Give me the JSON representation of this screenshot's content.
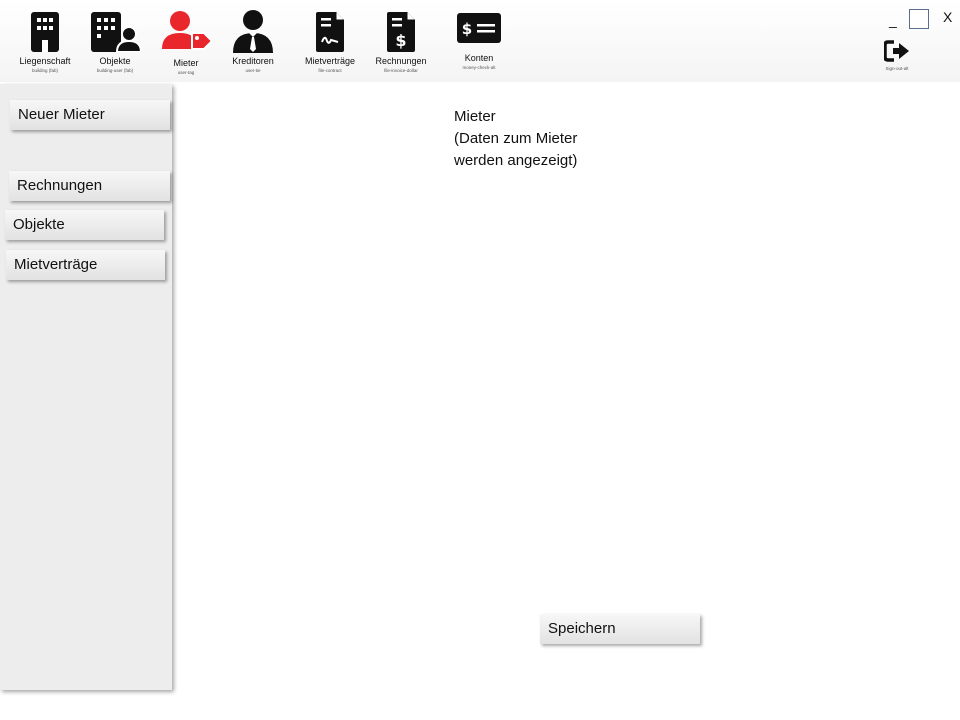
{
  "toolbar": {
    "items": [
      {
        "label": "Liegenschaft",
        "sub": "building (fab)",
        "icon": "building-icon"
      },
      {
        "label": "Objekte",
        "sub": "building-user (fab)",
        "icon": "building-user-icon"
      },
      {
        "label": "Mieter",
        "sub": "user-tag",
        "icon": "user-tag-icon",
        "active": true,
        "accent": "#e8262b"
      },
      {
        "label": "Kreditoren",
        "sub": "user-tie",
        "icon": "user-tie-icon"
      },
      {
        "label": "Mietverträge",
        "sub": "file-contract",
        "icon": "file-contract-icon"
      },
      {
        "label": "Rechnungen",
        "sub": "file-invoice-dollar",
        "icon": "file-invoice-dollar-icon"
      },
      {
        "label": "Konten",
        "sub": "money-check-alt",
        "icon": "money-check-icon"
      }
    ]
  },
  "window": {
    "minimize": "_",
    "close": "X",
    "signout_sub": "Sign-out-alt"
  },
  "sidebar": {
    "items": [
      {
        "label": "Neuer Mieter"
      },
      {
        "label": "Rechnungen"
      },
      {
        "label": "Objekte"
      },
      {
        "label": "Mietverträge"
      }
    ]
  },
  "main": {
    "line1": "Mieter",
    "line2": "(Daten zum Mieter",
    "line3": "werden angezeigt)",
    "save_label": "Speichern"
  },
  "colors": {
    "accent": "#e8262b",
    "icon": "#111111"
  }
}
